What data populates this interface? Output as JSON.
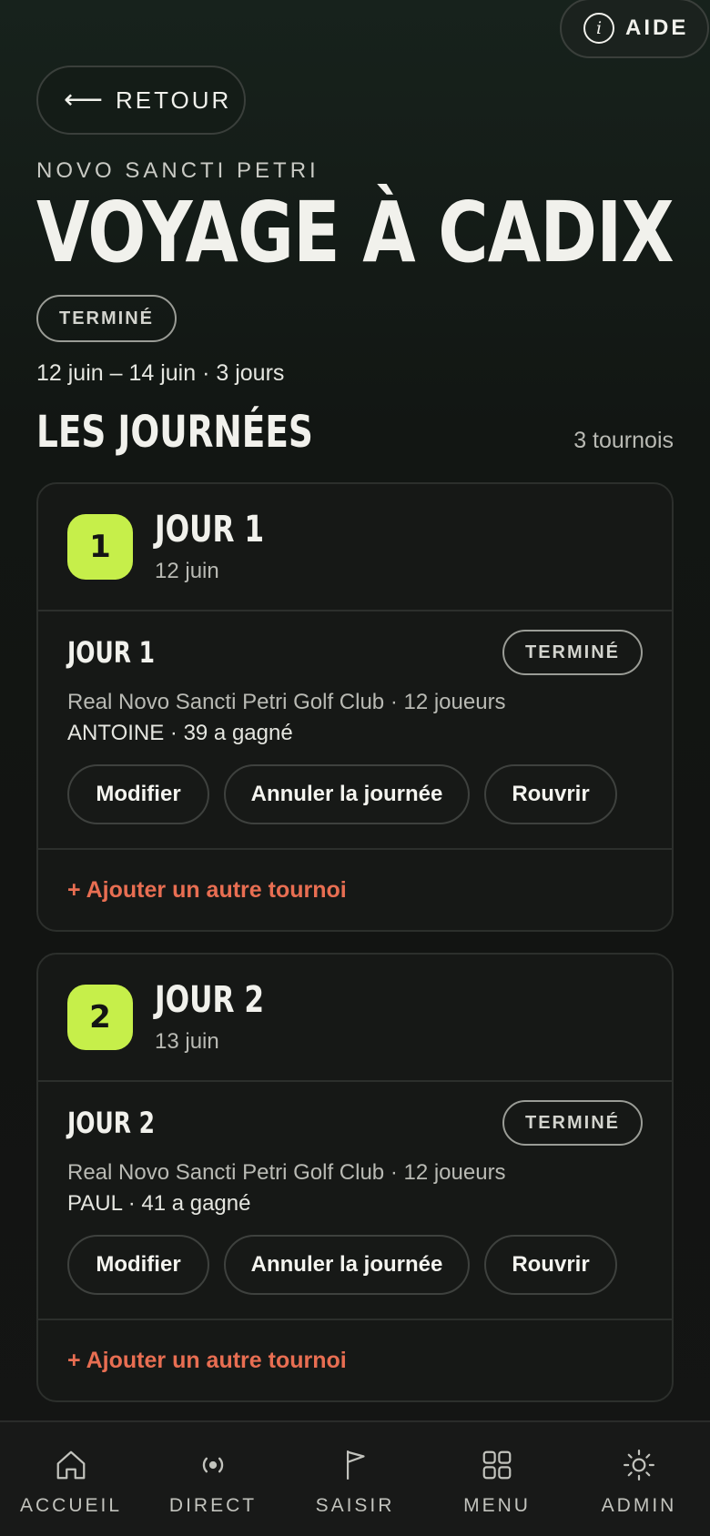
{
  "help": {
    "label": "AIDE",
    "icon": "info-icon"
  },
  "back": {
    "label": "RETOUR",
    "icon": "arrow-left-icon"
  },
  "trip": {
    "location": "NOVO SANCTI PETRI",
    "title": "VOYAGE À CADIX",
    "status": "TERMINÉ",
    "dates": "12 juin – 14 juin · 3 jours"
  },
  "section": {
    "title": "LES JOURNÉES",
    "count": "3 tournois"
  },
  "days": [
    {
      "number": "1",
      "name": "JOUR 1",
      "date": "12 juin",
      "tournament": {
        "name": "JOUR 1",
        "status": "TERMINÉ",
        "meta": "Real Novo Sancti Petri Golf Club · 12 joueurs",
        "winner": "ANTOINE · 39 a gagné",
        "edit": "Modifier",
        "cancel": "Annuler la journée",
        "reopen": "Rouvrir"
      },
      "add": "+ Ajouter un autre tournoi"
    },
    {
      "number": "2",
      "name": "JOUR 2",
      "date": "13 juin",
      "tournament": {
        "name": "JOUR 2",
        "status": "TERMINÉ",
        "meta": "Real Novo Sancti Petri Golf Club · 12 joueurs",
        "winner": "PAUL · 41 a gagné",
        "edit": "Modifier",
        "cancel": "Annuler la journée",
        "reopen": "Rouvrir"
      },
      "add": "+ Ajouter un autre tournoi"
    }
  ],
  "nav": [
    {
      "label": "ACCUEIL",
      "icon": "home-icon"
    },
    {
      "label": "DIRECT",
      "icon": "live-icon"
    },
    {
      "label": "SAISIR",
      "icon": "flag-icon"
    },
    {
      "label": "MENU",
      "icon": "grid-icon"
    },
    {
      "label": "ADMIN",
      "icon": "sun-icon"
    }
  ],
  "colors": {
    "accent": "#c6ef4a",
    "link": "#e86e52",
    "background": "#121412"
  }
}
